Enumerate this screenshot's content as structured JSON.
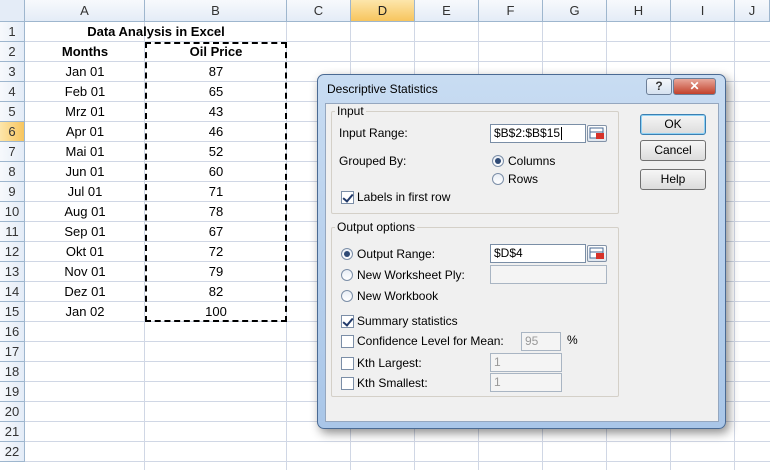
{
  "spreadsheet": {
    "columns": [
      "A",
      "B",
      "C",
      "D",
      "E",
      "F",
      "G",
      "H",
      "I",
      "J"
    ],
    "rows": [
      "1",
      "2",
      "3",
      "4",
      "5",
      "6",
      "7",
      "8",
      "9",
      "10",
      "11",
      "12",
      "13",
      "14",
      "15",
      "16",
      "17",
      "18",
      "19",
      "20",
      "21",
      "22"
    ],
    "title": "Data Analysis in Excel",
    "header_months": "Months",
    "header_price": "Oil Price",
    "months": [
      "Jan 01",
      "Feb 01",
      "Mrz 01",
      "Apr 01",
      "Mai 01",
      "Jun 01",
      "Jul 01",
      "Aug 01",
      "Sep 01",
      "Okt 01",
      "Nov 01",
      "Dez 01",
      "Jan 02"
    ],
    "prices": [
      "87",
      "65",
      "43",
      "46",
      "52",
      "60",
      "71",
      "78",
      "67",
      "72",
      "79",
      "82",
      "100"
    ]
  },
  "dialog": {
    "title": "Descriptive Statistics",
    "help_glyph": "?",
    "close_glyph": "✕",
    "input_group": "Input",
    "input_range_label": "Input Range:",
    "input_range_value": "$B$2:$B$15",
    "grouped_by_label": "Grouped By:",
    "columns_label": "Columns",
    "rows_label": "Rows",
    "labels_first_row": "Labels in first row",
    "output_group": "Output options",
    "output_range_label": "Output Range:",
    "output_range_value": "$D$4",
    "new_ply_label": "New Worksheet Ply:",
    "new_workbook_label": "New Workbook",
    "summary_label": "Summary statistics",
    "confidence_label": "Confidence Level for Mean:",
    "confidence_value": "95",
    "percent": "%",
    "kth_largest_label": "Kth Largest:",
    "kth_largest_value": "1",
    "kth_smallest_label": "Kth Smallest:",
    "kth_smallest_value": "1",
    "ok": "OK",
    "cancel": "Cancel",
    "help": "Help"
  }
}
